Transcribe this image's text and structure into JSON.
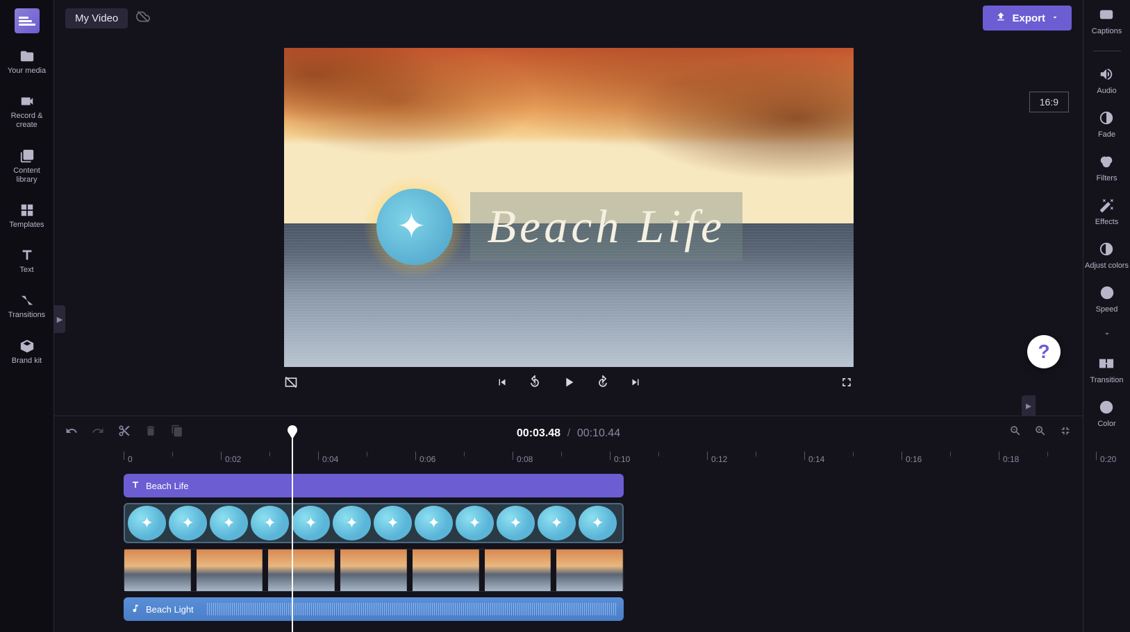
{
  "project": {
    "name": "My Video"
  },
  "export": {
    "label": "Export"
  },
  "leftNav": [
    {
      "label": "Your media"
    },
    {
      "label": "Record & create"
    },
    {
      "label": "Content library"
    },
    {
      "label": "Templates"
    },
    {
      "label": "Text"
    },
    {
      "label": "Transitions"
    },
    {
      "label": "Brand kit"
    }
  ],
  "rightNav": [
    {
      "label": "Captions"
    },
    {
      "label": "Audio"
    },
    {
      "label": "Fade"
    },
    {
      "label": "Filters"
    },
    {
      "label": "Effects"
    },
    {
      "label": "Adjust colors"
    },
    {
      "label": "Speed"
    },
    {
      "label": "Transition"
    },
    {
      "label": "Color"
    }
  ],
  "preview": {
    "aspectRatio": "16:9",
    "overlayText": "Beach Life"
  },
  "playback": {
    "currentTime": "00:03.48",
    "separator": "/",
    "totalTime": "00:10.44"
  },
  "ruler": {
    "marks": [
      "0",
      "0:02",
      "0:04",
      "0:06",
      "0:08",
      "0:10",
      "0:12",
      "0:14",
      "0:16",
      "0:18",
      "0:20"
    ]
  },
  "tracks": {
    "text": {
      "label": "Beach Life"
    },
    "audio": {
      "label": "Beach Light"
    }
  },
  "help": {
    "symbol": "?"
  }
}
